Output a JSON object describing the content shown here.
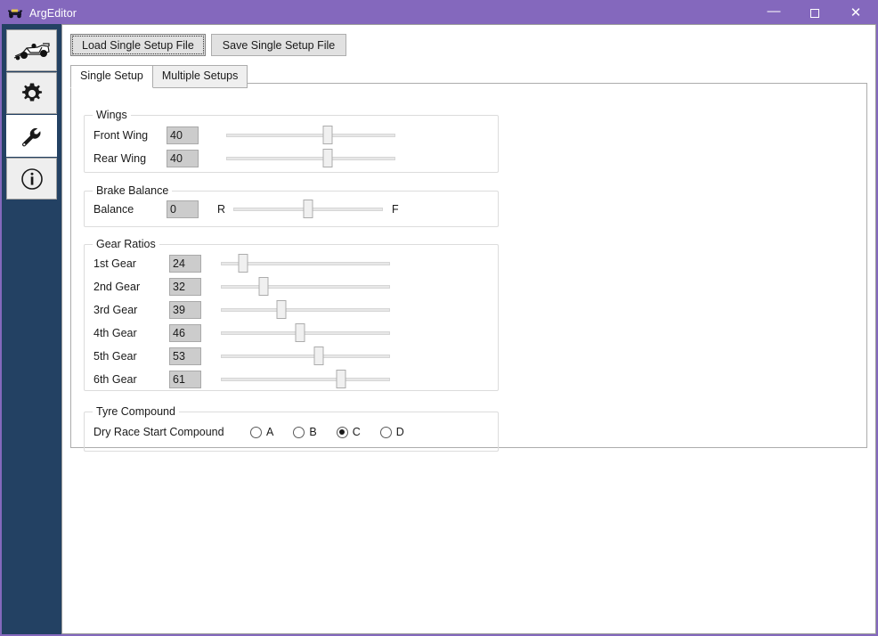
{
  "window": {
    "title": "ArgEditor",
    "title_icon": "race-car-icon",
    "accent_color": "#8468bd",
    "sidebar_color": "#234163",
    "controls": {
      "minimize": "—",
      "maximize": "□",
      "close": "✕"
    }
  },
  "sidebar": {
    "items": [
      {
        "icon": "race-car-icon",
        "name": "sidebar-item-car"
      },
      {
        "icon": "gear-icon",
        "name": "sidebar-item-settings"
      },
      {
        "icon": "wrench-icon",
        "name": "sidebar-item-tools"
      },
      {
        "icon": "info-icon",
        "name": "sidebar-item-info"
      }
    ]
  },
  "toolbar": {
    "load_label": "Load Single Setup File",
    "save_label": "Save Single Setup File"
  },
  "tabs": [
    {
      "label": "Single Setup",
      "active": true
    },
    {
      "label": "Multiple Setups",
      "active": false
    }
  ],
  "groups": {
    "wings": {
      "title": "Wings",
      "rows": [
        {
          "label": "Front Wing",
          "value": "40",
          "percent": 60
        },
        {
          "label": "Rear Wing",
          "value": "40",
          "percent": 60
        }
      ]
    },
    "brake_balance": {
      "title": "Brake Balance",
      "row": {
        "label": "Balance",
        "value": "0",
        "percent": 50,
        "left_label": "R",
        "right_label": "F"
      }
    },
    "gear_ratios": {
      "title": "Gear Ratios",
      "rows": [
        {
          "label": "1st Gear",
          "value": "24",
          "percent": 13
        },
        {
          "label": "2nd Gear",
          "value": "32",
          "percent": 25
        },
        {
          "label": "3rd Gear",
          "value": "39",
          "percent": 36
        },
        {
          "label": "4th Gear",
          "value": "46",
          "percent": 47
        },
        {
          "label": "5th Gear",
          "value": "53",
          "percent": 58
        },
        {
          "label": "6th Gear",
          "value": "61",
          "percent": 71
        }
      ]
    },
    "tyre_compound": {
      "title": "Tyre Compound",
      "row_label": "Dry Race Start Compound",
      "options": [
        {
          "label": "A",
          "selected": false
        },
        {
          "label": "B",
          "selected": false
        },
        {
          "label": "C",
          "selected": true
        },
        {
          "label": "D",
          "selected": false
        }
      ]
    }
  }
}
